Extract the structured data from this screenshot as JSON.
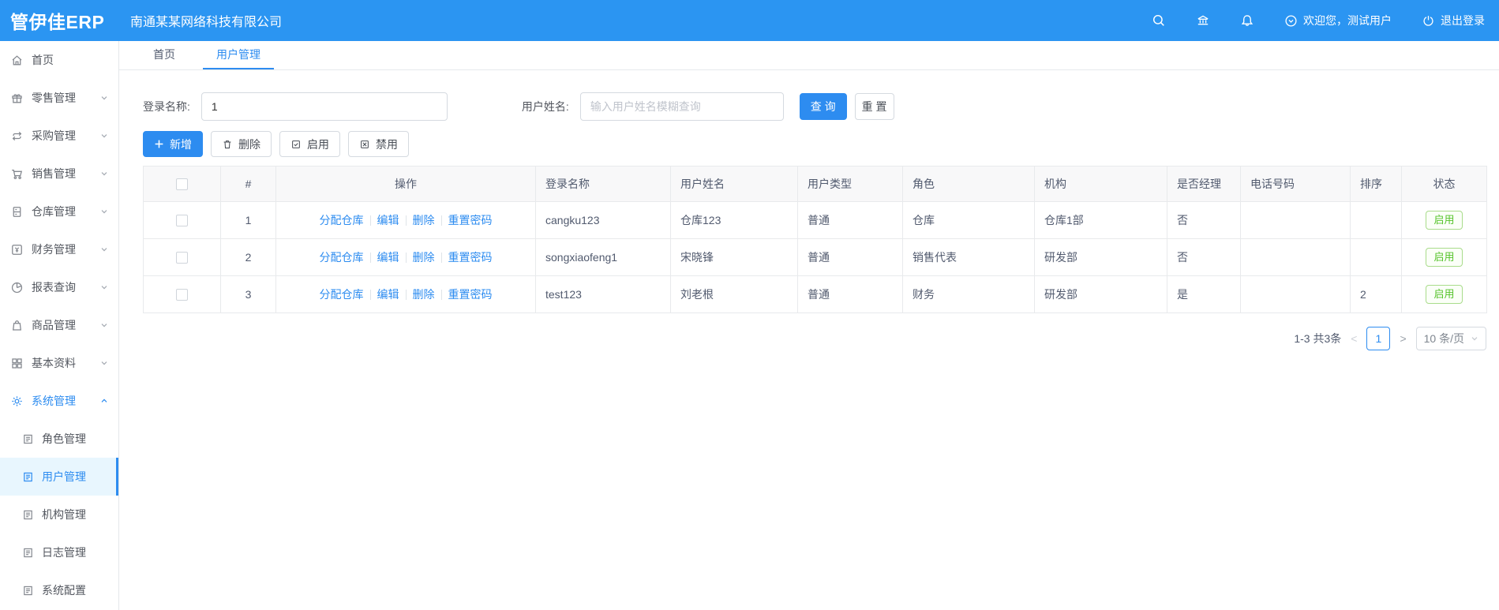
{
  "header": {
    "logo": "管伊佳ERP",
    "company": "南通某某网络科技有限公司",
    "icons": [
      "search-icon",
      "bank-icon",
      "bell-icon"
    ],
    "welcome_text": "欢迎您，测试用户",
    "logout_text": "退出登录"
  },
  "tabs": [
    {
      "label": "首页",
      "active": false
    },
    {
      "label": "用户管理",
      "active": true
    }
  ],
  "sidebar": {
    "items": [
      {
        "label": "首页",
        "icon": "home-icon",
        "level": "top"
      },
      {
        "label": "零售管理",
        "icon": "retail-icon",
        "level": "top",
        "expandable": true
      },
      {
        "label": "采购管理",
        "icon": "purchase-icon",
        "level": "top",
        "expandable": true
      },
      {
        "label": "销售管理",
        "icon": "sales-cart-icon",
        "level": "top",
        "expandable": true
      },
      {
        "label": "仓库管理",
        "icon": "warehouse-icon",
        "level": "top",
        "expandable": true
      },
      {
        "label": "财务管理",
        "icon": "finance-icon",
        "level": "top",
        "expandable": true
      },
      {
        "label": "报表查询",
        "icon": "report-pie-icon",
        "level": "top",
        "expandable": true
      },
      {
        "label": "商品管理",
        "icon": "product-bag-icon",
        "level": "top",
        "expandable": true
      },
      {
        "label": "基本资料",
        "icon": "basic-data-icon",
        "level": "top",
        "expandable": true
      },
      {
        "label": "系统管理",
        "icon": "system-gear-icon",
        "level": "top",
        "expandable": true,
        "expanded": true,
        "active": true
      },
      {
        "label": "角色管理",
        "icon": "document-icon",
        "level": "sub"
      },
      {
        "label": "用户管理",
        "icon": "document-icon",
        "level": "sub",
        "selected": true
      },
      {
        "label": "机构管理",
        "icon": "document-icon",
        "level": "sub"
      },
      {
        "label": "日志管理",
        "icon": "document-icon",
        "level": "sub"
      },
      {
        "label": "系统配置",
        "icon": "document-icon",
        "level": "sub"
      }
    ]
  },
  "filters": {
    "login_name_label": "登录名称:",
    "login_name_value": "1",
    "user_name_label": "用户姓名:",
    "user_name_placeholder": "输入用户姓名模糊查询",
    "search_label": "查 询",
    "reset_label": "重 置"
  },
  "toolbar": {
    "add_label": "新增",
    "delete_label": "删除",
    "enable_label": "启用",
    "disable_label": "禁用"
  },
  "table": {
    "columns": [
      "",
      "#",
      "操作",
      "登录名称",
      "用户姓名",
      "用户类型",
      "角色",
      "机构",
      "是否经理",
      "电话号码",
      "排序",
      "状态"
    ],
    "op_links": [
      "分配仓库",
      "编辑",
      "删除",
      "重置密码"
    ],
    "rows": [
      {
        "index": "1",
        "login": "cangku123",
        "name": "仓库123",
        "type": "普通",
        "role": "仓库",
        "org": "仓库1部",
        "manager": "否",
        "phone": "",
        "sort": "",
        "status": "启用"
      },
      {
        "index": "2",
        "login": "songxiaofeng1",
        "name": "宋晓锋",
        "type": "普通",
        "role": "销售代表",
        "org": "研发部",
        "manager": "否",
        "phone": "",
        "sort": "",
        "status": "启用"
      },
      {
        "index": "3",
        "login": "test123",
        "name": "刘老根",
        "type": "普通",
        "role": "财务",
        "org": "研发部",
        "manager": "是",
        "phone": "",
        "sort": "2",
        "status": "启用"
      }
    ]
  },
  "pagination": {
    "total_text": "1-3 共3条",
    "prev_label": "<",
    "current_page": "1",
    "next_label": ">",
    "page_size_text": "10 条/页"
  },
  "colors": {
    "header_blue": "#2b95f2",
    "primary_blue": "#2d8cf0",
    "selected_bg": "#e8f6fe",
    "status_green": "#55c32a",
    "table_border": "#e8eaec"
  }
}
